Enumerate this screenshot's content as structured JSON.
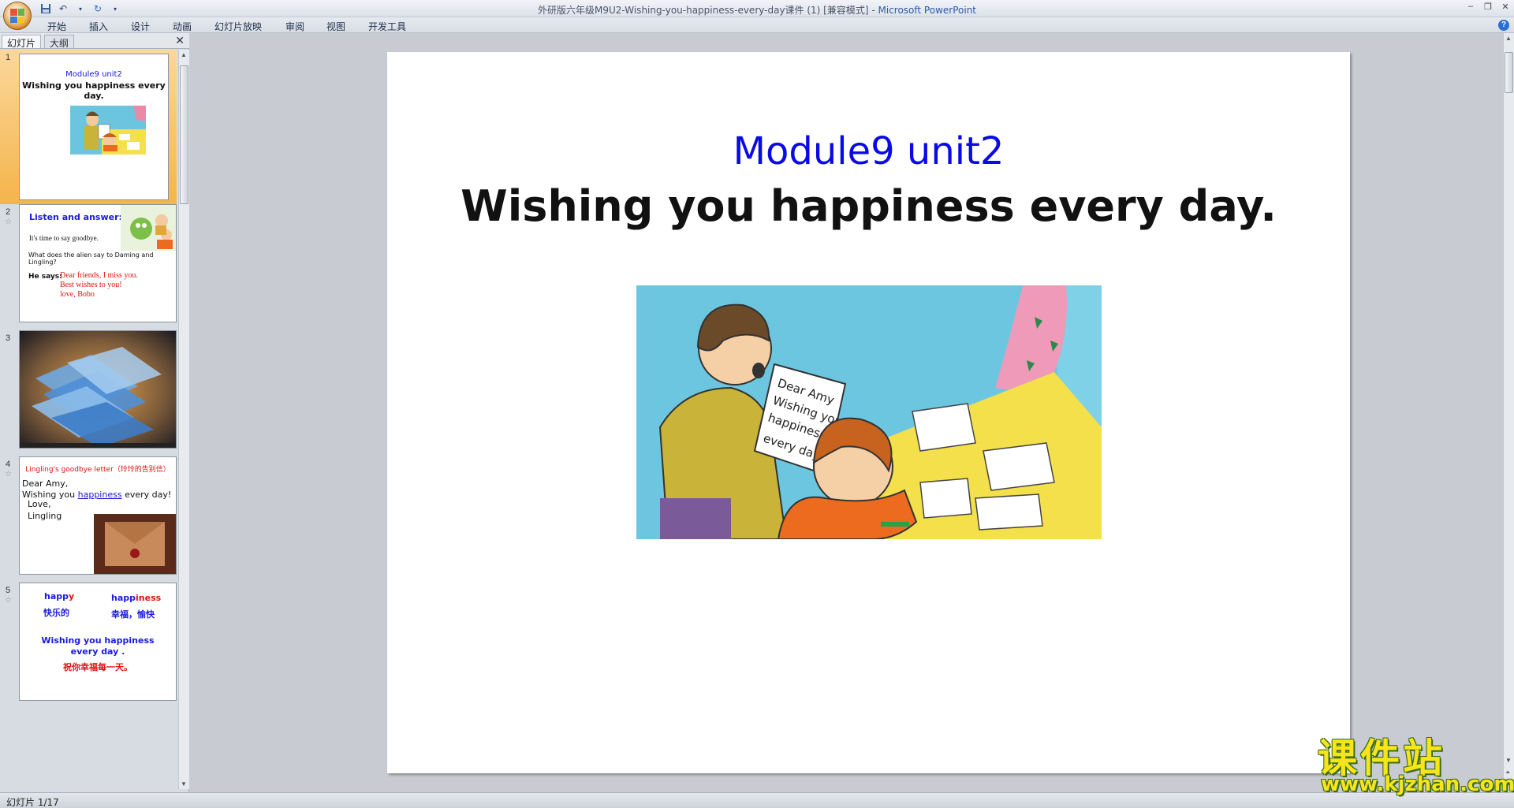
{
  "window": {
    "title": "外研版六年级M9U2-Wishing-you-happiness-every-day课件 (1) [兼容模式] - ",
    "app_name": "Microsoft PowerPoint",
    "controls": [
      "–",
      "❐",
      "✕"
    ]
  },
  "ribbon": {
    "tabs": [
      "开始",
      "插入",
      "设计",
      "动画",
      "幻灯片放映",
      "审阅",
      "视图",
      "开发工具"
    ]
  },
  "left_panel": {
    "tab_slides": "幻灯片",
    "tab_outline": "大纲",
    "selected_slide": 1,
    "slides": [
      {
        "number": "1",
        "subtitle": "Module9 unit2",
        "title": "Wishing you happiness every day."
      },
      {
        "number": "2",
        "heading": "Listen and answer:",
        "line1": "It's time to say goodbye.",
        "line2": "What does the alien say to Daming and Lingling?",
        "says_label": "He says:",
        "says_text": [
          "Dear friends, I miss you.",
          "Best wishes to you!",
          "love, Bobo"
        ]
      },
      {
        "number": "3"
      },
      {
        "number": "4",
        "heading": "Lingling's  goodbye letter（玲玲的告别信）",
        "lines": [
          "Dear Amy,",
          "Wishing you",
          "happiness",
          "every day!",
          "Love,",
          "Lingling"
        ]
      },
      {
        "number": "5",
        "word1": "happ",
        "word1_end": "y",
        "word1_cn": "快乐的",
        "word2": "happ",
        "word2_end": "iness",
        "word2_cn": "幸福，愉快",
        "sentence": "Wishing  you  happiness",
        "sentence2": "every  day .",
        "sentence_cn": "祝你幸福每一天。"
      }
    ]
  },
  "slide": {
    "subtitle": "Module9 unit2",
    "title": "Wishing you happiness every day.",
    "image_letter_text": [
      "Dear Amy",
      "Wishing you",
      "happiness",
      "every day"
    ]
  },
  "status": {
    "slide_indicator": "幻灯片 1/17"
  },
  "watermark": {
    "cn": "课件站",
    "url": "www.kjzhan.com"
  }
}
